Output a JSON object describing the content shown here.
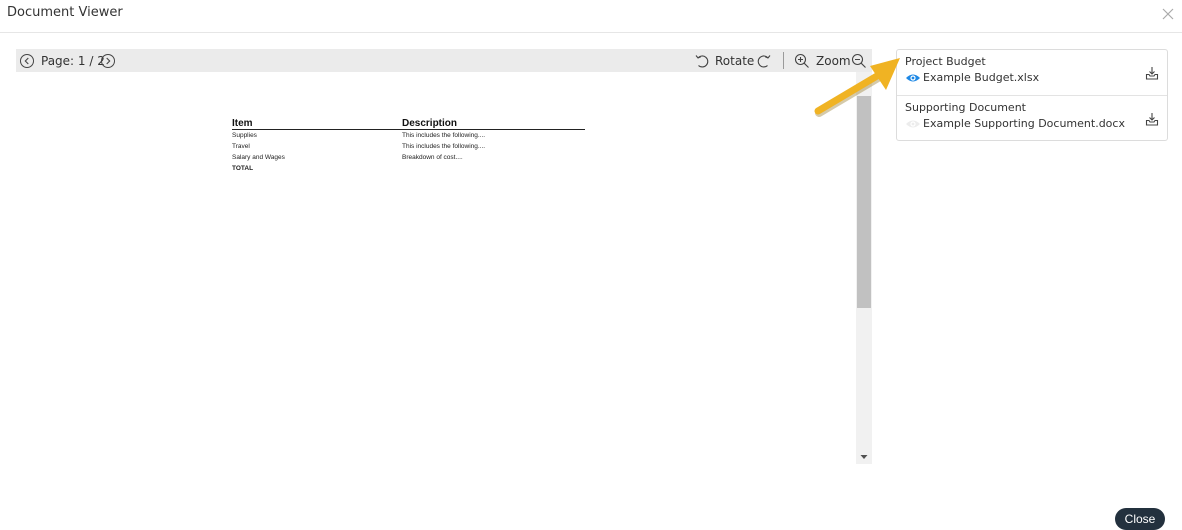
{
  "window": {
    "title": "Document Viewer"
  },
  "toolbar": {
    "page_label": "Page: 1 / 2",
    "rotate_label": "Rotate",
    "zoom_label": "Zoom"
  },
  "document": {
    "headers": [
      "Item",
      "Description"
    ],
    "rows": [
      [
        "Supplies",
        "This includes the following...."
      ],
      [
        "Travel",
        "This includes the following...."
      ],
      [
        "Salary and Wages",
        "Breakdown of cost...."
      ],
      [
        "TOTAL",
        ""
      ]
    ]
  },
  "attachments": [
    {
      "title": "Project Budget",
      "file": "Example Budget.xlsx",
      "viewing": true
    },
    {
      "title": "Supporting Document",
      "file": "Example Supporting Document.docx",
      "viewing": false
    }
  ],
  "footer": {
    "close_label": "Close"
  },
  "colors": {
    "accent": "#1e88e5",
    "arrow": "#f0b323",
    "close_button": "#23313e",
    "toolbar_bg": "#ebebeb"
  },
  "icons": [
    "close-icon",
    "chevron-left-icon",
    "chevron-right-icon",
    "rotate-left-icon",
    "rotate-right-icon",
    "zoom-in-icon",
    "zoom-out-icon",
    "eye-icon",
    "download-icon"
  ]
}
